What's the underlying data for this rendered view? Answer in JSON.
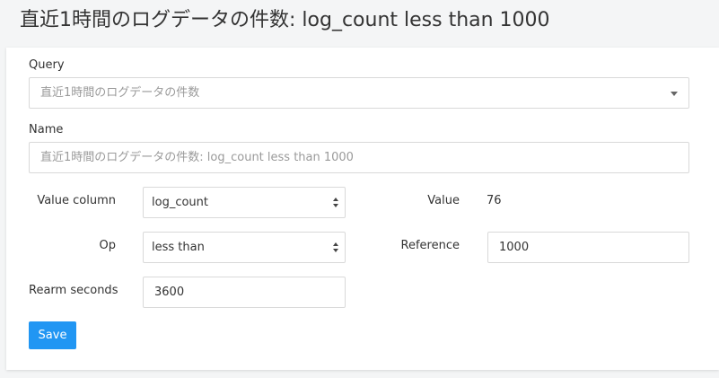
{
  "page": {
    "title": "直近1時間のログデータの件数: log_count less than 1000"
  },
  "form": {
    "query": {
      "label": "Query",
      "value": "直近1時間のログデータの件数"
    },
    "name": {
      "label": "Name",
      "value": "直近1時間のログデータの件数: log_count less than 1000"
    },
    "value_column": {
      "label": "Value column",
      "value": "log_count"
    },
    "value": {
      "label": "Value",
      "value": "76"
    },
    "op": {
      "label": "Op",
      "value": "less than"
    },
    "reference": {
      "label": "Reference",
      "value": "1000"
    },
    "rearm_seconds": {
      "label": "Rearm seconds",
      "value": "3600"
    },
    "save_label": "Save"
  },
  "colors": {
    "primary_button": "#2196f3",
    "background": "#f4f5f6",
    "card": "#ffffff"
  }
}
